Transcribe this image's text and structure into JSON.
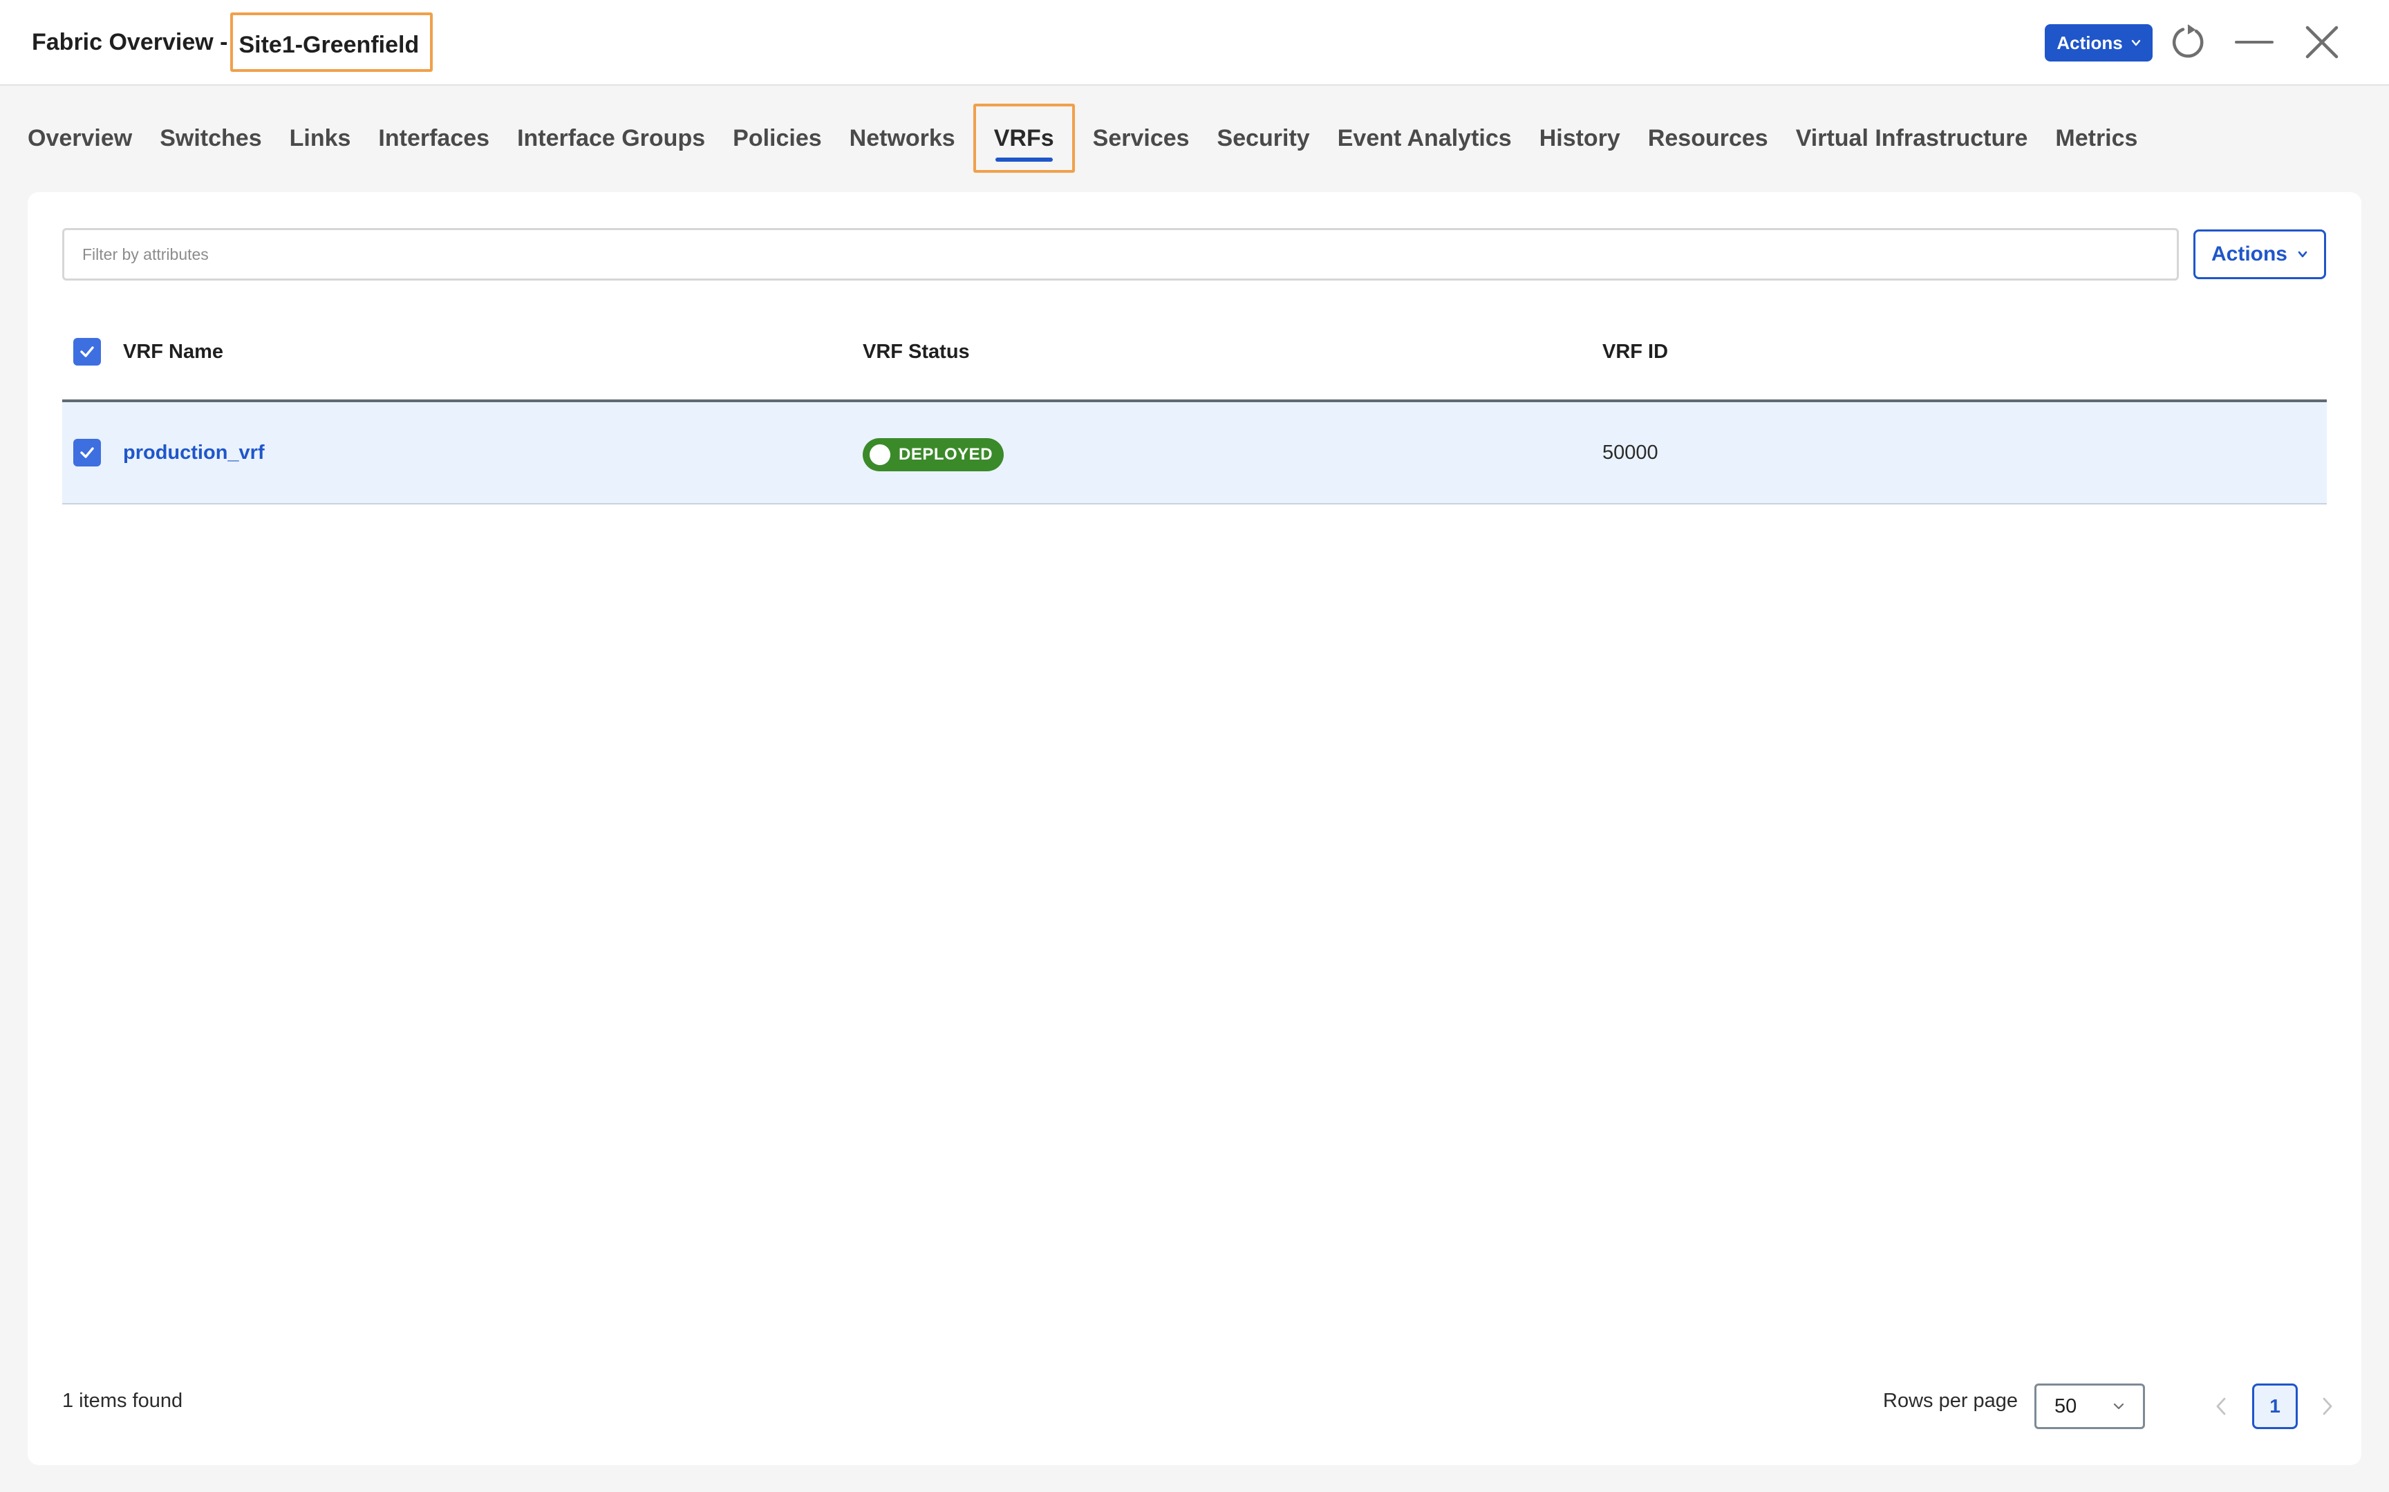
{
  "header": {
    "title_prefix": "Fabric Overview -",
    "fabric_name": "Site1-Greenfield",
    "actions_label": "Actions"
  },
  "tabs": [
    {
      "label": "Overview"
    },
    {
      "label": "Switches"
    },
    {
      "label": "Links"
    },
    {
      "label": "Interfaces"
    },
    {
      "label": "Interface Groups"
    },
    {
      "label": "Policies"
    },
    {
      "label": "Networks"
    },
    {
      "label": "VRFs",
      "active": true
    },
    {
      "label": "Services"
    },
    {
      "label": "Security"
    },
    {
      "label": "Event Analytics"
    },
    {
      "label": "History"
    },
    {
      "label": "Resources"
    },
    {
      "label": "Virtual Infrastructure"
    },
    {
      "label": "Metrics"
    }
  ],
  "toolbar": {
    "filter_placeholder": "Filter by attributes",
    "filter_value": "",
    "actions_label": "Actions"
  },
  "table": {
    "columns": [
      "VRF Name",
      "VRF Status",
      "VRF ID"
    ],
    "select_all_checked": true,
    "rows": [
      {
        "name": "production_vrf",
        "status": "DEPLOYED",
        "id": "50000",
        "checked": true
      }
    ]
  },
  "footer": {
    "items_found": "1 items found",
    "rows_per_page_label": "Rows per page",
    "rows_per_page_value": "50",
    "current_page": "1"
  },
  "colors": {
    "accent": "#1f56c9",
    "highlight_box": "#f0a04b",
    "deployed_badge": "#3b8a2a",
    "selected_row": "#eaf2fd"
  },
  "icons": {
    "refresh": "refresh-icon",
    "minimize": "minimize-icon",
    "close": "close-icon",
    "dropdown": "chevron-down-icon",
    "checkbox": "checkmark-icon",
    "prev": "chevron-left-icon",
    "next": "chevron-right-icon"
  }
}
